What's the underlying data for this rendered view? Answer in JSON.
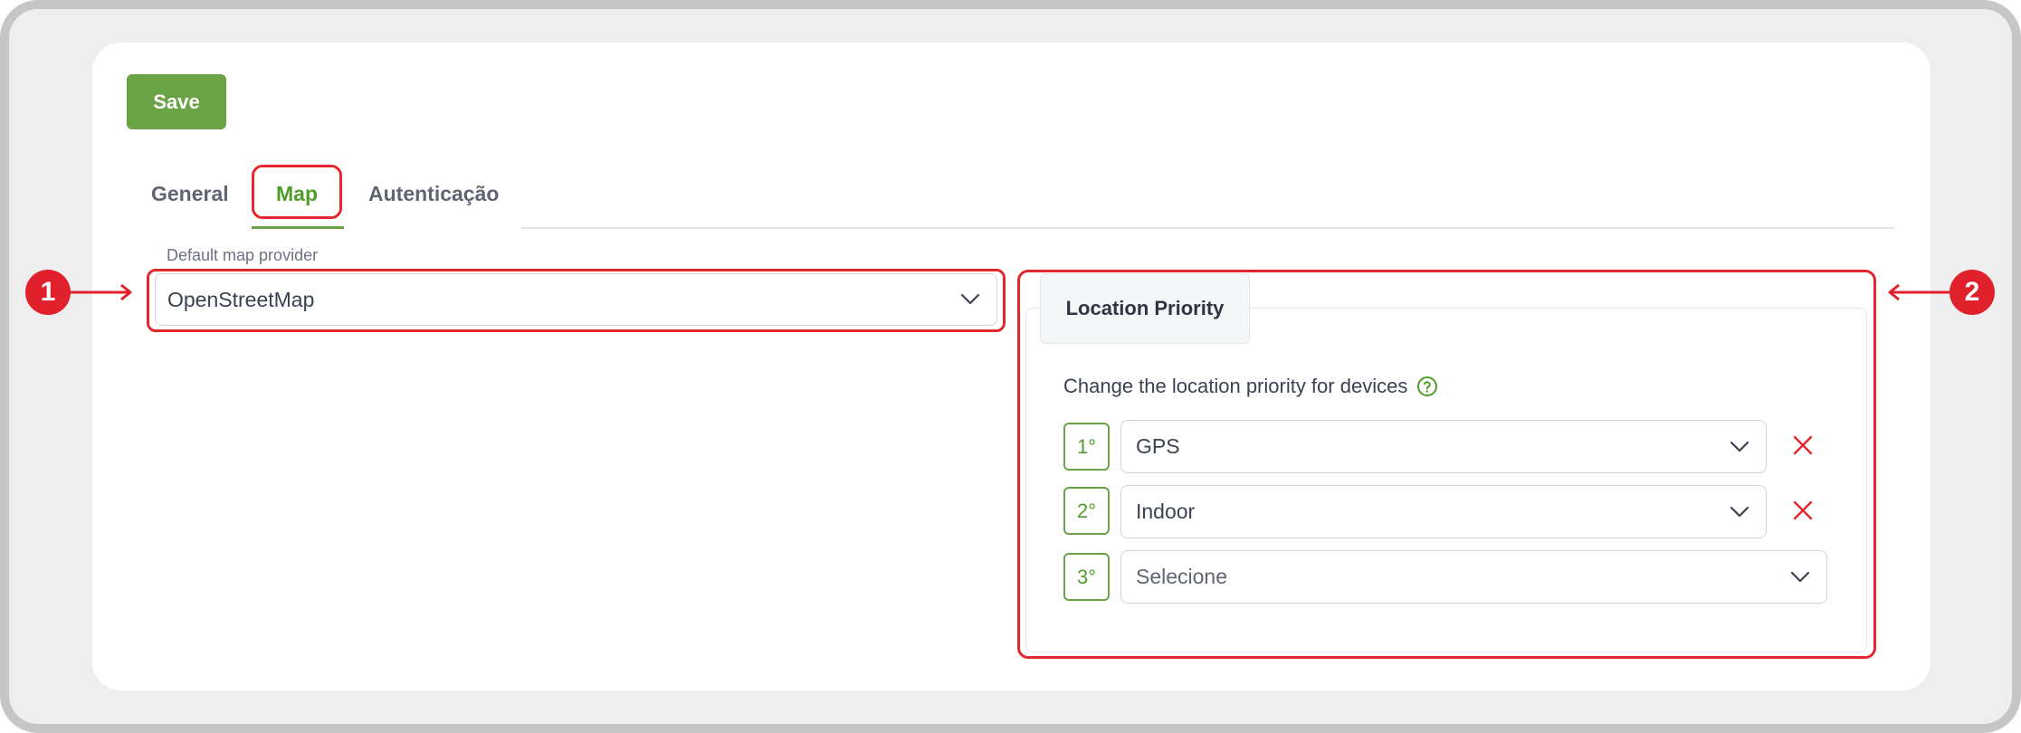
{
  "toolbar": {
    "save_label": "Save"
  },
  "tabs": [
    {
      "label": "General",
      "active": false
    },
    {
      "label": "Map",
      "active": true
    },
    {
      "label": "Autenticação",
      "active": false
    }
  ],
  "map_settings": {
    "provider_label": "Default map provider",
    "provider_value": "OpenStreetMap"
  },
  "location_priority": {
    "title": "Location Priority",
    "description": "Change the location priority for devices",
    "rows": [
      {
        "rank": "1°",
        "value": "GPS",
        "removable": true
      },
      {
        "rank": "2°",
        "value": "Indoor",
        "removable": true
      },
      {
        "rank": "3°",
        "value": "Selecione",
        "removable": false
      }
    ]
  },
  "annotations": {
    "marker_1": "1",
    "marker_2": "2"
  },
  "colors": {
    "accent": "#6aa345",
    "highlight": "#e0282e",
    "marker": "#e0202a"
  },
  "icons": [
    "chevron-down-icon",
    "help-circle-icon",
    "close-icon",
    "arrow-right-icon",
    "arrow-left-icon"
  ]
}
